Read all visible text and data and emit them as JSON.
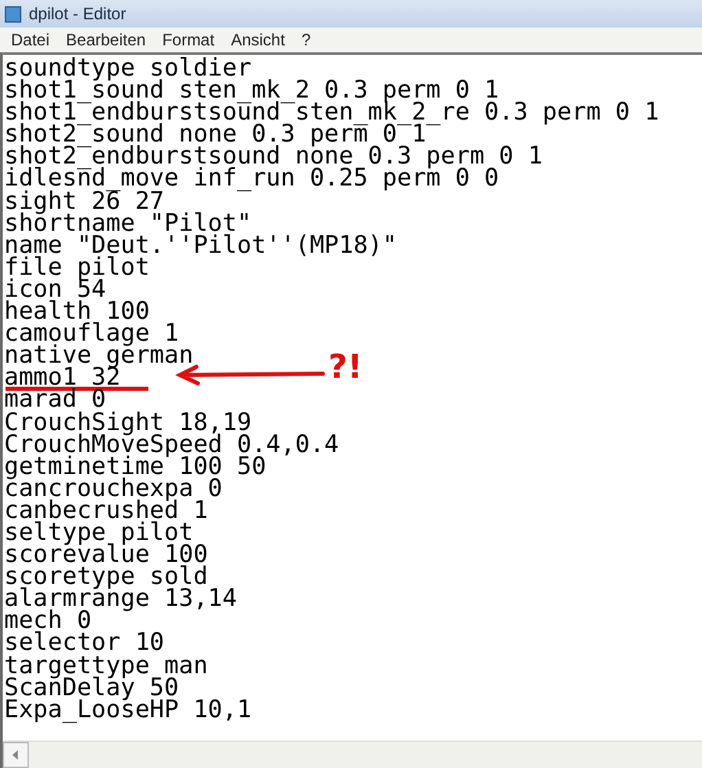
{
  "window": {
    "title": "dpilot - Editor"
  },
  "menu": [
    "Datei",
    "Bearbeiten",
    "Format",
    "Ansicht",
    "?"
  ],
  "lines": [
    {
      "text": "soundtype soldier",
      "marked": false
    },
    {
      "text": "shot1_sound sten_mk_2 0.3 perm 0 1",
      "marked": false
    },
    {
      "text": "shot1_endburstsound sten_mk_2_re 0.3 perm 0 1",
      "marked": false
    },
    {
      "text": "shot2_sound none 0.3 perm 0 1",
      "marked": false
    },
    {
      "text": "shot2_endburstsound none 0.3 perm 0 1",
      "marked": false
    },
    {
      "text": "idlesnd_move inf_run 0.25 perm 0 0",
      "marked": false
    },
    {
      "text": "sight 26 27",
      "marked": false
    },
    {
      "text": "shortname \"Pilot\"",
      "marked": false
    },
    {
      "text": "name \"Deut.''Pilot''(MP18)\"",
      "marked": false
    },
    {
      "text": "file pilot",
      "marked": false
    },
    {
      "text": "icon 54",
      "marked": false
    },
    {
      "text": "health 100",
      "marked": false
    },
    {
      "text": "camouflage 1",
      "marked": false
    },
    {
      "text": "native german",
      "marked": false
    },
    {
      "text": "ammo1 32",
      "marked": true
    },
    {
      "text": "marad 0",
      "marked": false
    },
    {
      "text": "CrouchSight 18,19",
      "marked": false
    },
    {
      "text": "CrouchMoveSpeed 0.4,0.4",
      "marked": false
    },
    {
      "text": "getminetime 100 50",
      "marked": false
    },
    {
      "text": "cancrouchexpa 0",
      "marked": false
    },
    {
      "text": "canbecrushed 1",
      "marked": false
    },
    {
      "text": "seltype pilot",
      "marked": false
    },
    {
      "text": "scorevalue 100",
      "marked": false
    },
    {
      "text": "scoretype sold",
      "marked": false
    },
    {
      "text": "alarmrange 13,14",
      "marked": false
    },
    {
      "text": "mech 0",
      "marked": false
    },
    {
      "text": "selector 10",
      "marked": false
    },
    {
      "text": "targettype man",
      "marked": false
    },
    {
      "text": "ScanDelay 50",
      "marked": false
    },
    {
      "text": "Expa_LooseHP 10,1",
      "marked": false
    }
  ],
  "annotation": {
    "text": "?!"
  }
}
